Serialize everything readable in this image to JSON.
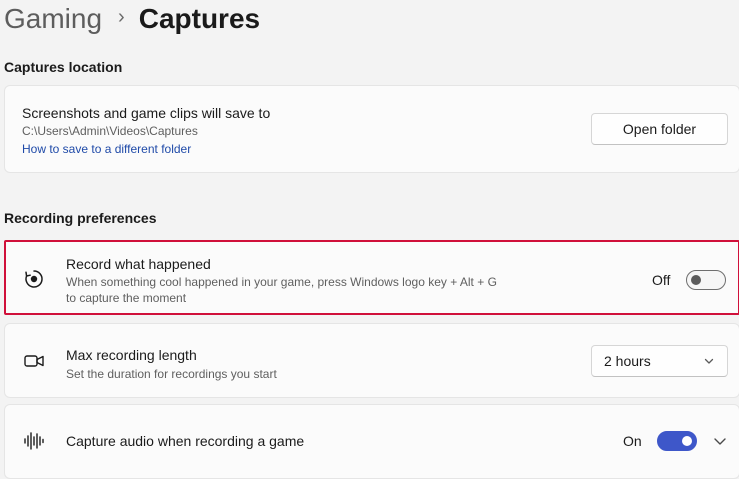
{
  "breadcrumb": {
    "parent": "Gaming",
    "separator": "›",
    "current": "Captures"
  },
  "captures_location": {
    "section_title": "Captures location",
    "card": {
      "title": "Screenshots and game clips will save to",
      "path": "C:\\Users\\Admin\\Videos\\Captures",
      "link": "How to save to a different folder",
      "button": "Open folder"
    }
  },
  "recording_preferences": {
    "section_title": "Recording preferences",
    "record_what_happened": {
      "icon": "record-icon",
      "title": "Record what happened",
      "description_line1": "When something cool happened in your game, press Windows logo key + Alt + G",
      "description_line2": "to capture the moment",
      "toggle_state_label": "Off",
      "toggle_on": false,
      "highlight_color": "#d0103a"
    },
    "max_recording_length": {
      "icon": "video-camera-icon",
      "title": "Max recording length",
      "description": "Set the duration for recordings you start",
      "selected_value": "2 hours"
    },
    "capture_audio": {
      "icon": "audio-waveform-icon",
      "title": "Capture audio when recording a game",
      "toggle_state_label": "On",
      "toggle_on": true,
      "accent_color": "#3e57c9"
    }
  }
}
